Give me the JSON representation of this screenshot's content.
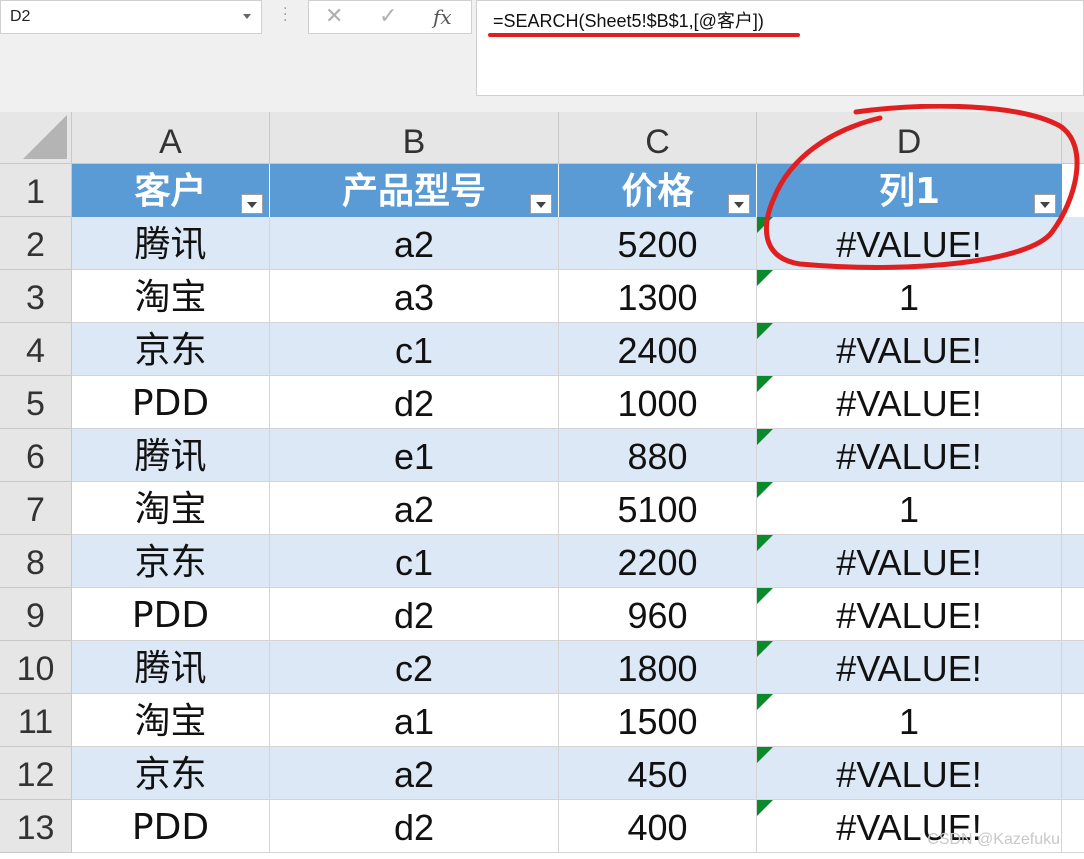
{
  "formula_bar": {
    "name_box": "D2",
    "formula": "=SEARCH(Sheet5!$B$1,[@客户])",
    "cancel_icon": "✕",
    "enter_icon": "✓",
    "fx_label": "fx"
  },
  "columns": [
    "A",
    "B",
    "C",
    "D"
  ],
  "table": {
    "headers": [
      "客户",
      "产品型号",
      "价格",
      "列1"
    ],
    "rows": [
      {
        "row": "2",
        "a": "腾讯",
        "b": "a2",
        "c": "5200",
        "d": "#VALUE!"
      },
      {
        "row": "3",
        "a": "淘宝",
        "b": "a3",
        "c": "1300",
        "d": "1"
      },
      {
        "row": "4",
        "a": "京东",
        "b": "c1",
        "c": "2400",
        "d": "#VALUE!"
      },
      {
        "row": "5",
        "a": "PDD",
        "b": "d2",
        "c": "1000",
        "d": "#VALUE!"
      },
      {
        "row": "6",
        "a": "腾讯",
        "b": "e1",
        "c": "880",
        "d": "#VALUE!"
      },
      {
        "row": "7",
        "a": "淘宝",
        "b": "a2",
        "c": "5100",
        "d": "1"
      },
      {
        "row": "8",
        "a": "京东",
        "b": "c1",
        "c": "2200",
        "d": "#VALUE!"
      },
      {
        "row": "9",
        "a": "PDD",
        "b": "d2",
        "c": "960",
        "d": "#VALUE!"
      },
      {
        "row": "10",
        "a": "腾讯",
        "b": "c2",
        "c": "1800",
        "d": "#VALUE!"
      },
      {
        "row": "11",
        "a": "淘宝",
        "b": "a1",
        "c": "1500",
        "d": "1"
      },
      {
        "row": "12",
        "a": "京东",
        "b": "a2",
        "c": "450",
        "d": "#VALUE!"
      },
      {
        "row": "13",
        "a": "PDD",
        "b": "d2",
        "c": "400",
        "d": "#VALUE!"
      }
    ]
  },
  "header_row_number": "1",
  "watermark": "CSDN @Kazefuku",
  "colors": {
    "header_fill": "#5b9bd5",
    "band_fill": "#dce8f5",
    "annotation_red": "#e02020",
    "error_marker": "#0a8a2a"
  }
}
